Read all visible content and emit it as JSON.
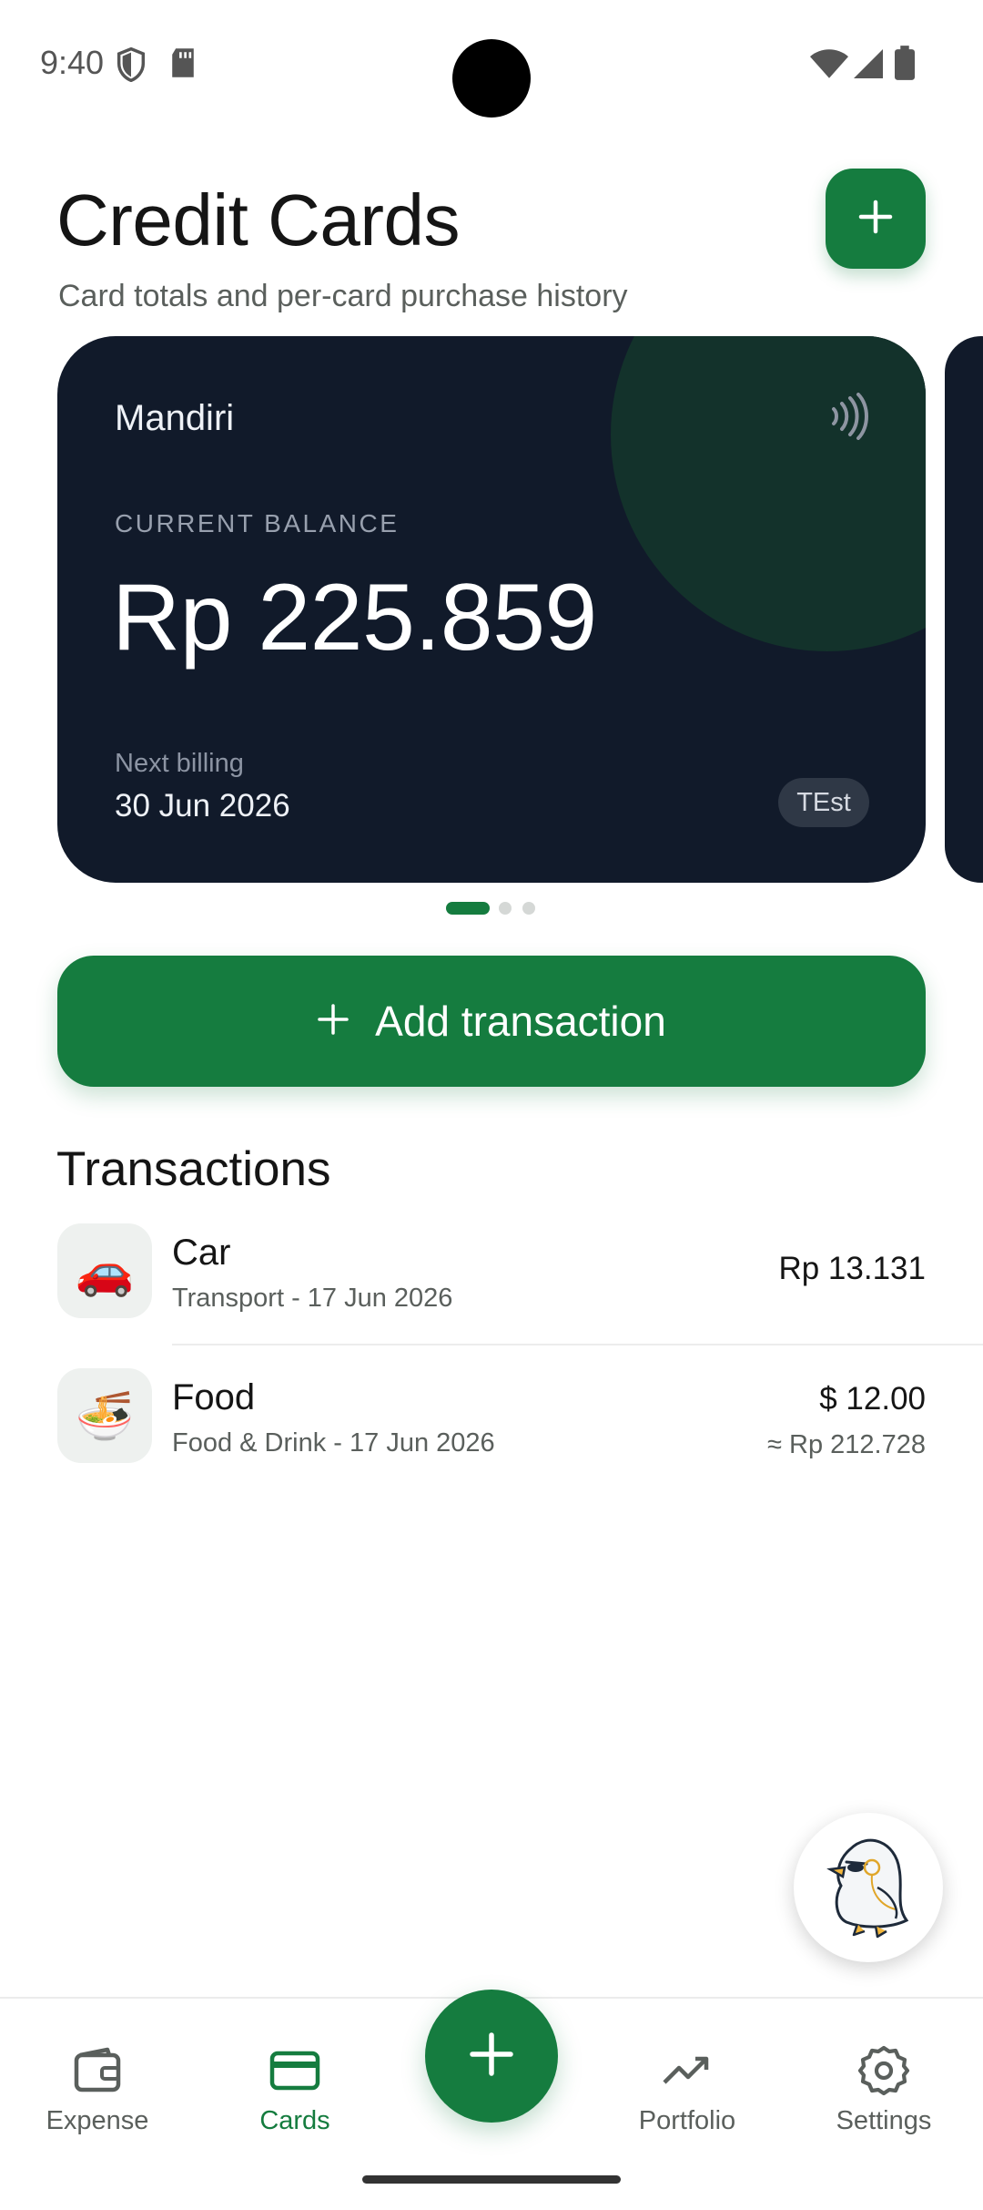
{
  "status_bar": {
    "time": "9:40"
  },
  "header": {
    "title": "Credit Cards",
    "subtitle": "Card totals and per-card purchase history"
  },
  "card": {
    "name": "Mandiri",
    "balance_label": "CURRENT BALANCE",
    "balance": "Rp 225.859",
    "billing_label": "Next billing",
    "billing_date": "30 Jun 2026",
    "tag": "TEst",
    "color": "#111a2a"
  },
  "pager": {
    "pages": 3,
    "active_index": 0
  },
  "add_transaction": {
    "label": "Add transaction"
  },
  "transactions": {
    "title": "Transactions",
    "items": [
      {
        "icon": "🚗",
        "name": "Car",
        "meta": "Transport - 17 Jun 2026",
        "amount": "Rp 13.131",
        "converted": ""
      },
      {
        "icon": "🍜",
        "name": "Food",
        "meta": "Food & Drink - 17 Jun 2026",
        "amount": "$ 12.00",
        "converted": "≈ Rp 212.728"
      }
    ]
  },
  "nav": {
    "items": [
      {
        "label": "Expense",
        "icon": "wallet-icon",
        "active": false
      },
      {
        "label": "Cards",
        "icon": "credit-card-icon",
        "active": true
      },
      {
        "label": "Portfolio",
        "icon": "trending-up-icon",
        "active": false
      },
      {
        "label": "Settings",
        "icon": "gear-icon",
        "active": false
      }
    ]
  },
  "theme": {
    "accent": "#157c3f",
    "card_bg": "#111a2a"
  }
}
